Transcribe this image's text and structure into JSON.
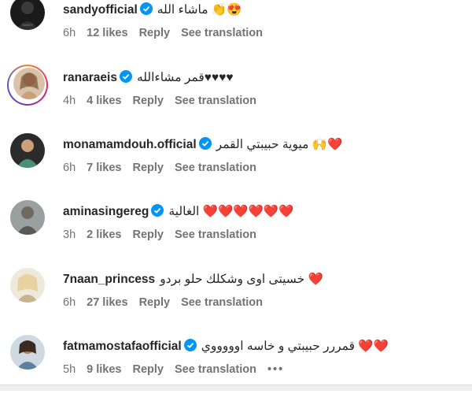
{
  "comments": [
    {
      "username": "sandyofficial",
      "text": "ماشاء الله 👏😍",
      "time": "6h",
      "likes": "12 likes",
      "reply": "Reply",
      "translate": "See translation",
      "verified": true
    },
    {
      "username": "ranaraeis",
      "text": "قمر مشاءالله♥♥♥♥",
      "time": "4h",
      "likes": "4 likes",
      "reply": "Reply",
      "translate": "See translation",
      "verified": true,
      "story_ring": true
    },
    {
      "username": "monamamdouh.official",
      "text": "ميوية حبيبتي القمر 🙌❤️",
      "time": "6h",
      "likes": "7 likes",
      "reply": "Reply",
      "translate": "See translation",
      "verified": true
    },
    {
      "username": "aminasingereg",
      "text": "الغالية ❤️❤️❤️❤️❤️❤️",
      "time": "3h",
      "likes": "2 likes",
      "reply": "Reply",
      "translate": "See translation",
      "verified": true
    },
    {
      "username": "7naan_princess",
      "text": "خسيتى اوى وشكلك حلو بردو ❤️",
      "time": "6h",
      "likes": "27 likes",
      "reply": "Reply",
      "translate": "See translation",
      "verified": false
    },
    {
      "username": "fatmamostafaofficial",
      "text": "قمررر حبيبتي و خاسه اوووووي ❤️❤️",
      "time": "5h",
      "likes": "9 likes",
      "reply": "Reply",
      "translate": "See translation",
      "verified": true,
      "more": "•••"
    }
  ],
  "colors": {
    "verified_blue": "#0095f6",
    "heart_red": "#ed2845",
    "meta_grey": "#737373"
  }
}
